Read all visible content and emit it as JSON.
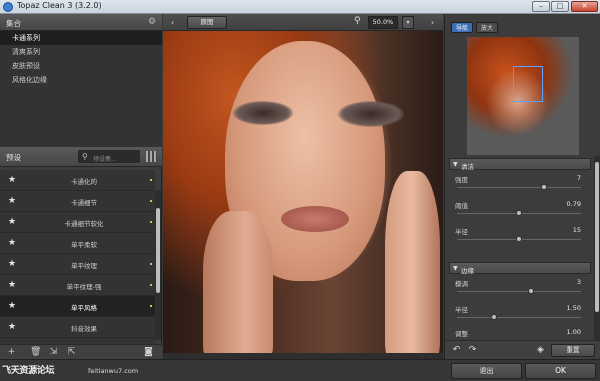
{
  "window": {
    "title": "Topaz Clean 3 (3.2.0)",
    "minimize": "–",
    "maximize": "□",
    "close": "✕"
  },
  "collections": {
    "header": "集合",
    "items": [
      "卡通系列",
      "清爽系列",
      "皮肤预设",
      "风格化边缘"
    ],
    "selected_index": 0
  },
  "presets": {
    "header": "预设",
    "search_placeholder": "预设集...",
    "items": [
      "卡通化的",
      "卡通细节",
      "卡通细节软化",
      "单平柔软",
      "单平纹理",
      "单平纹理-强",
      "单平风格",
      "抖音效果"
    ],
    "selected_index": 6
  },
  "canvas": {
    "original_label": "原图",
    "zoom": "50.0%"
  },
  "navigator": {
    "tab_active": "导航",
    "tab_inactive": "放大"
  },
  "sections": [
    {
      "label": "清洁",
      "params": [
        {
          "name": "强度",
          "value": "7",
          "level": 0.7
        },
        {
          "name": "阈值",
          "value": "0.79",
          "level": 0.5
        },
        {
          "name": "半径",
          "value": "15",
          "level": 0.5
        }
      ]
    },
    {
      "label": "边缘",
      "params": [
        {
          "name": "模调",
          "value": "3",
          "level": 0.6
        },
        {
          "name": "半径",
          "value": "1.50",
          "level": 0.3
        },
        {
          "name": "调整",
          "value": "1.00",
          "level": 0.5
        }
      ]
    }
  ],
  "right_toolbar": {
    "undo_icon": "undo-icon",
    "redo_icon": "redo-icon",
    "reset_label": "重置"
  },
  "footer": {
    "watermark_logo": "飞天资源论坛",
    "watermark_url": "feitianwu7.com",
    "cancel_label": "退出",
    "ok_label": "OK"
  },
  "colors": {
    "accent": "#3a6fb3",
    "panel": "#3c3c3c"
  }
}
